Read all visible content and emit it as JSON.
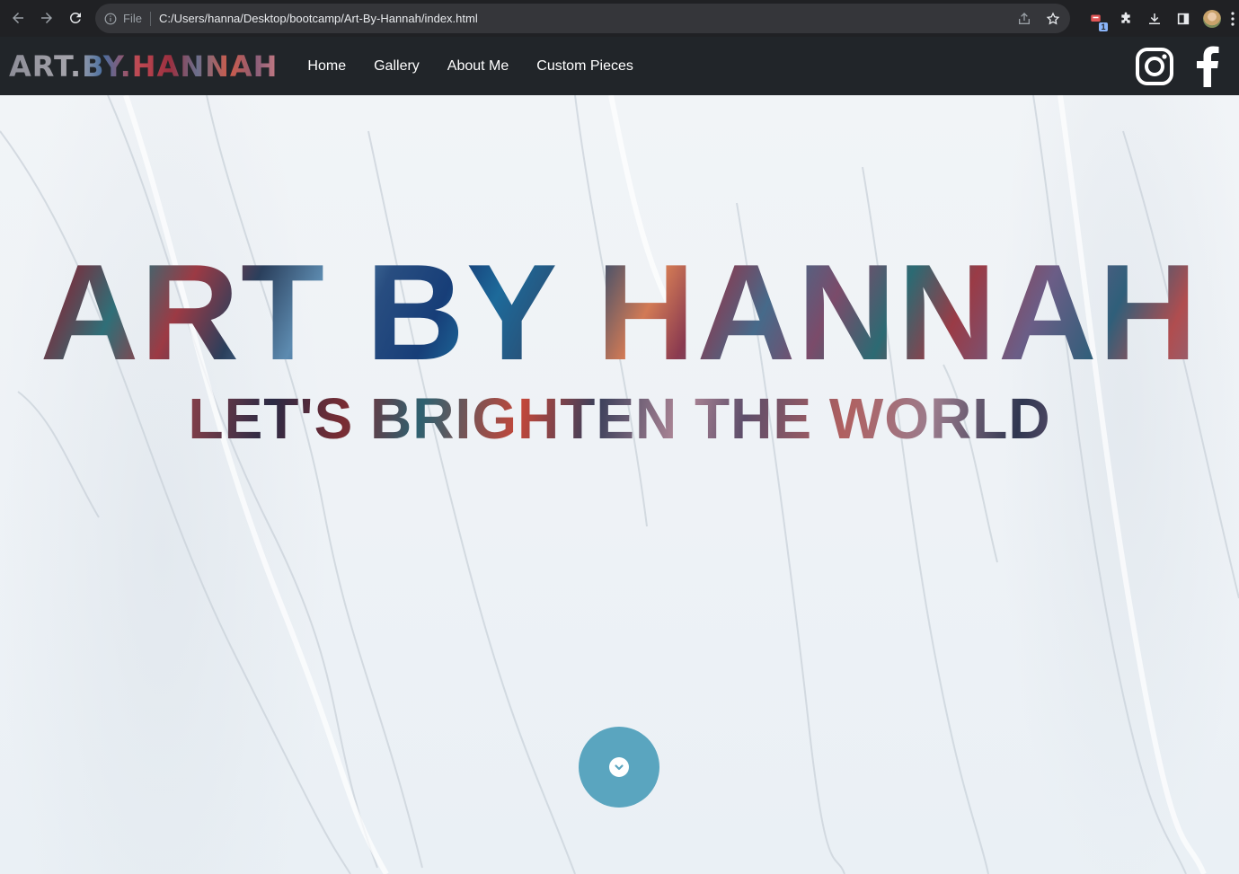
{
  "browser": {
    "protocol_label": "File",
    "url": "C:/Users/hanna/Desktop/bootcamp/Art-By-Hannah/index.html",
    "extension_badge": "1"
  },
  "navbar": {
    "brand": "ART.BY.HANNAH",
    "links": [
      {
        "label": "Home"
      },
      {
        "label": "Gallery"
      },
      {
        "label": "About Me"
      },
      {
        "label": "Custom Pieces"
      }
    ],
    "social_icons": [
      "instagram-icon",
      "facebook-icon"
    ]
  },
  "hero": {
    "title": "ART BY HANNAH",
    "subtitle": "LET'S BRIGHTEN THE WORLD",
    "scroll_icon": "chevron-down-icon"
  },
  "colors": {
    "chrome_bg": "#202124",
    "omnibox_bg": "#35363a",
    "navbar_bg": "#212529",
    "scroll_button": "#5aa5bf",
    "hero_bg": "#eef2f6"
  }
}
